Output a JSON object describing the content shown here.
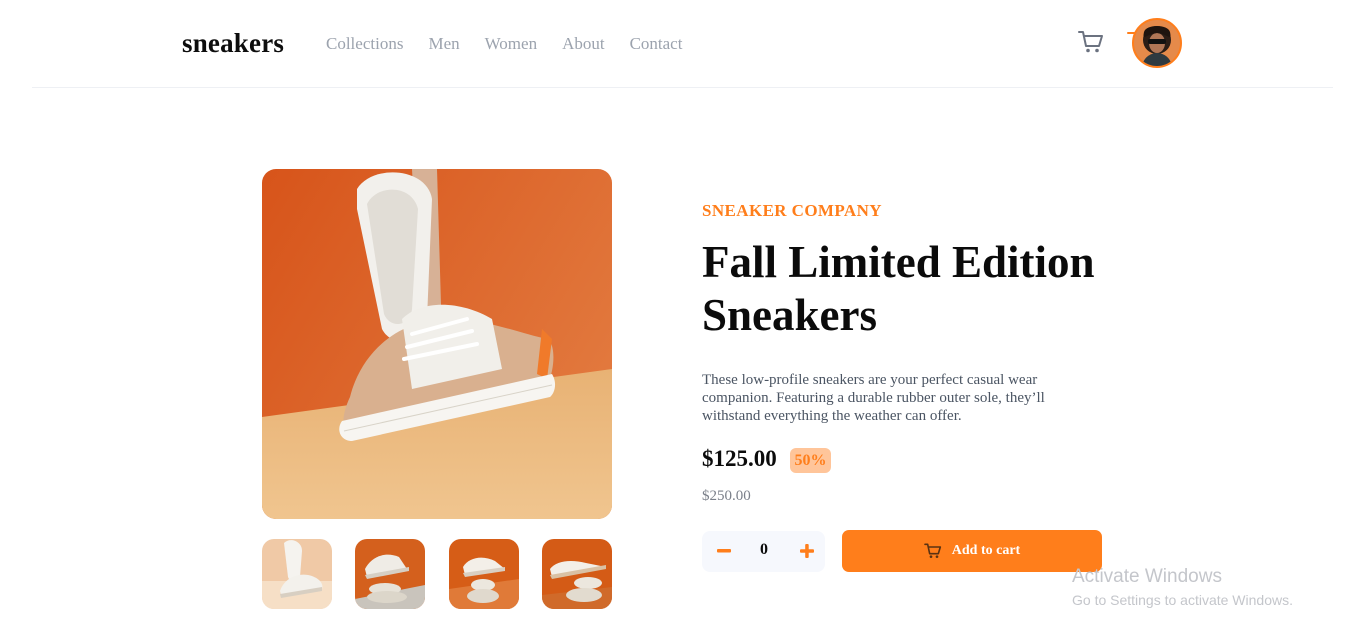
{
  "header": {
    "logo": "sneakers",
    "nav": [
      "Collections",
      "Men",
      "Women",
      "About",
      "Contact"
    ],
    "cart_icon": "cart-icon",
    "avatar_icon": "user-avatar"
  },
  "gallery": {
    "main_image": "sneaker-product-photo",
    "thumbnails": [
      "thumbnail-1",
      "thumbnail-2",
      "thumbnail-3",
      "thumbnail-4"
    ]
  },
  "product": {
    "company": "SNEAKER COMPANY",
    "title_line1": "Fall Limited Edition",
    "title_line2": "Sneakers",
    "description": "These low-profile sneakers are your perfect casual wear companion. Featuring a durable rubber outer sole, they’ll withstand everything the weather can offer.",
    "price": "$125.00",
    "discount": "50%",
    "original_price": "$250.00"
  },
  "cart_controls": {
    "quantity": "0",
    "add_label": "Add to cart"
  },
  "watermark": {
    "title": "Activate Windows",
    "subtitle": "Go to Settings to activate Windows."
  },
  "colors": {
    "accent": "#ff7e1b",
    "accent_pale": "#ffc59a",
    "text_dark": "#0b0b0b",
    "text_muted": "#9ca3ae"
  }
}
